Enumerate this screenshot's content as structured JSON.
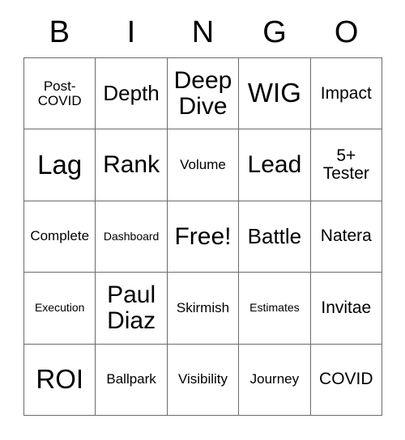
{
  "card": {
    "title": "BINGO",
    "header_letters": [
      "B",
      "I",
      "N",
      "G",
      "O"
    ],
    "grid_size": "5x5",
    "border_color": "#6b6b6b",
    "background_color": "#ffffff",
    "text_color": "#000000",
    "rows": [
      [
        {
          "text": "Post-\nCOVID",
          "size": "s"
        },
        {
          "text": "Depth",
          "size": "l"
        },
        {
          "text": "Deep\nDive",
          "size": "xl"
        },
        {
          "text": "WIG",
          "size": "xxl"
        },
        {
          "text": "Impact",
          "size": "m"
        }
      ],
      [
        {
          "text": "Lag",
          "size": "xxl"
        },
        {
          "text": "Rank",
          "size": "xl"
        },
        {
          "text": "Volume",
          "size": "s"
        },
        {
          "text": "Lead",
          "size": "xl"
        },
        {
          "text": "5+\nTester",
          "size": "m"
        }
      ],
      [
        {
          "text": "Complete",
          "size": "s"
        },
        {
          "text": "Dashboard",
          "size": "xs"
        },
        {
          "text": "Free!",
          "size": "xl"
        },
        {
          "text": "Battle",
          "size": "l"
        },
        {
          "text": "Natera",
          "size": "m"
        }
      ],
      [
        {
          "text": "Execution",
          "size": "xs"
        },
        {
          "text": "Paul\nDiaz",
          "size": "xl"
        },
        {
          "text": "Skirmish",
          "size": "s"
        },
        {
          "text": "Estimates",
          "size": "xs"
        },
        {
          "text": "Invitae",
          "size": "m"
        }
      ],
      [
        {
          "text": "ROI",
          "size": "xxl"
        },
        {
          "text": "Ballpark",
          "size": "s"
        },
        {
          "text": "Visibility",
          "size": "s"
        },
        {
          "text": "Journey",
          "size": "s"
        },
        {
          "text": "COVID",
          "size": "m"
        }
      ]
    ]
  }
}
